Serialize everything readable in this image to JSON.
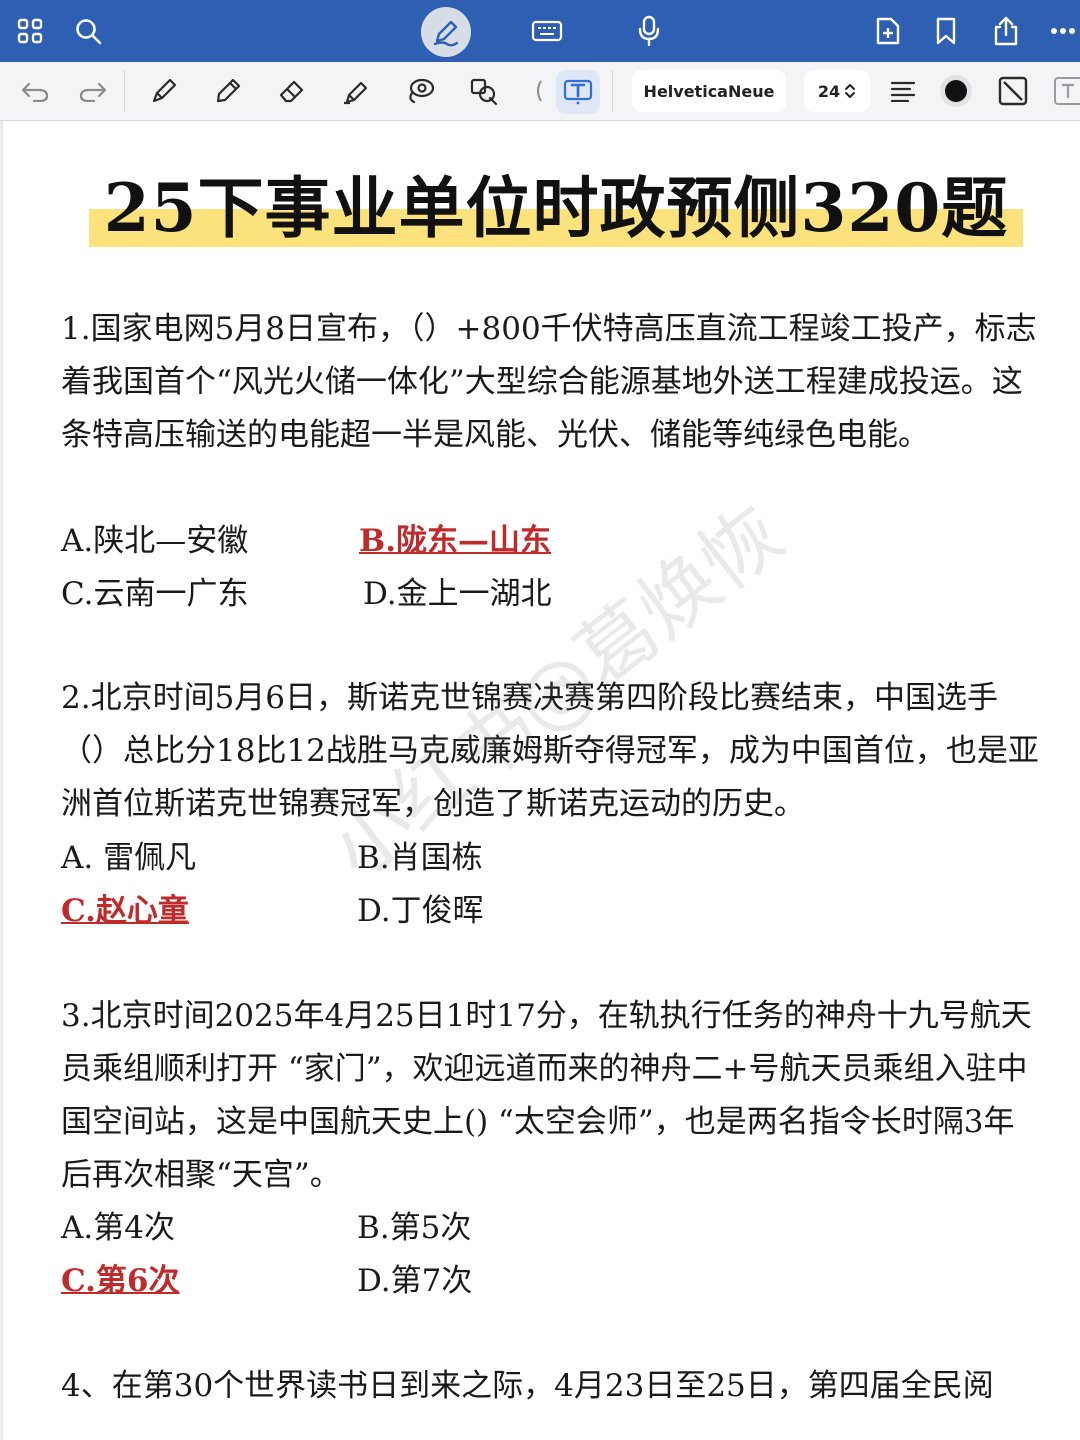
{
  "toolbar": {
    "font_name": "HelveticaNeue",
    "font_size": "24"
  },
  "document": {
    "title": "25下事业单位时政预侧320题",
    "watermark": "小红书@葛焕恢",
    "questions": [
      {
        "text": "1.国家电网5月8日宣布，（）+800千伏特高压直流工程竣工投产，标志着我国首个“风光火储一体化”大型综合能源基地外送工程建成投运。这条特高压输送的电能超一半是风能、光伏、储能等纯绿色电能。",
        "options": [
          "A.陕北—安徽",
          "B.陇东—山东",
          "C.云南一广东",
          "D.金上一湖北"
        ],
        "answer_index": 1
      },
      {
        "text": "2.北京时间5月6日，斯诺克世锦赛决赛第四阶段比赛结束，中国选手（）总比分18比12战胜马克威廉姆斯夺得冠军，成为中国首位，也是亚洲首位斯诺克世锦赛冠军，创造了斯诺克运动的历史。",
        "options": [
          "A. 雷佩凡",
          "B.肖国栋",
          "C.赵心童",
          "D.丁俊晖"
        ],
        "answer_index": 2
      },
      {
        "text": "3.北京时间2025年4月25日1时17分，在轨执行任务的神舟十九号航天员乘组顺利打开 “家门”，欢迎远道而来的神舟二+号航天员乘组入驻中国空间站，这是中国航天史上() “太空会师”，也是两名指令长时隔3年后再次相聚“天宫”。",
        "options": [
          "A.第4次",
          "B.第5次",
          "C.第6次",
          "D.第7次"
        ],
        "answer_index": 2
      },
      {
        "text": "4、在第30个世界读书日到来之际，4月23日至25日，第四届全民阅"
      }
    ]
  }
}
